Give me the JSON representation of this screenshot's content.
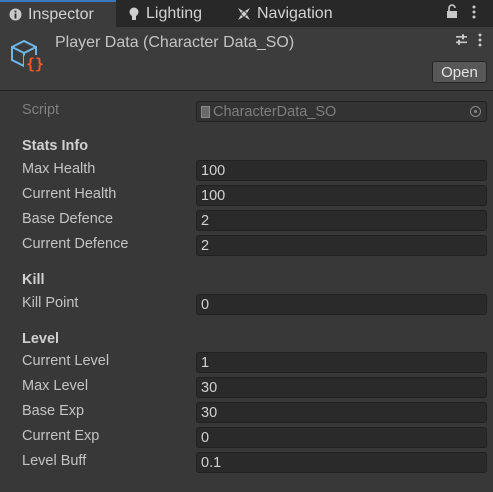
{
  "tabs": [
    {
      "label": "Inspector",
      "icon": "info-icon",
      "active": true
    },
    {
      "label": "Lighting",
      "icon": "bulb-icon",
      "active": false
    },
    {
      "label": "Navigation",
      "icon": "navigation-icon",
      "active": false
    }
  ],
  "header": {
    "object_title": "Player Data (Character Data_SO)",
    "open_label": "Open",
    "icon": "scriptable-object-icon"
  },
  "script": {
    "label": "Script",
    "value": "CharacterData_SO"
  },
  "sections": {
    "stats": {
      "title": "Stats Info",
      "fields": [
        {
          "label": "Max Health",
          "value": "100"
        },
        {
          "label": "Current Health",
          "value": "100"
        },
        {
          "label": "Base Defence",
          "value": "2"
        },
        {
          "label": "Current Defence",
          "value": "2"
        }
      ]
    },
    "kill": {
      "title": "Kill",
      "fields": [
        {
          "label": "Kill Point",
          "value": "0"
        }
      ]
    },
    "level": {
      "title": "Level",
      "fields": [
        {
          "label": "Current Level",
          "value": "1"
        },
        {
          "label": "Max Level",
          "value": "30"
        },
        {
          "label": "Base Exp",
          "value": "30"
        },
        {
          "label": "Current Exp",
          "value": "0"
        },
        {
          "label": "Level Buff",
          "value": "0.1"
        }
      ]
    }
  },
  "colors": {
    "accent": "#3a79bb",
    "panel": "#383838",
    "field": "#2a2a2a",
    "icon_blue": "#6fb7e6",
    "icon_orange": "#f05a28"
  }
}
